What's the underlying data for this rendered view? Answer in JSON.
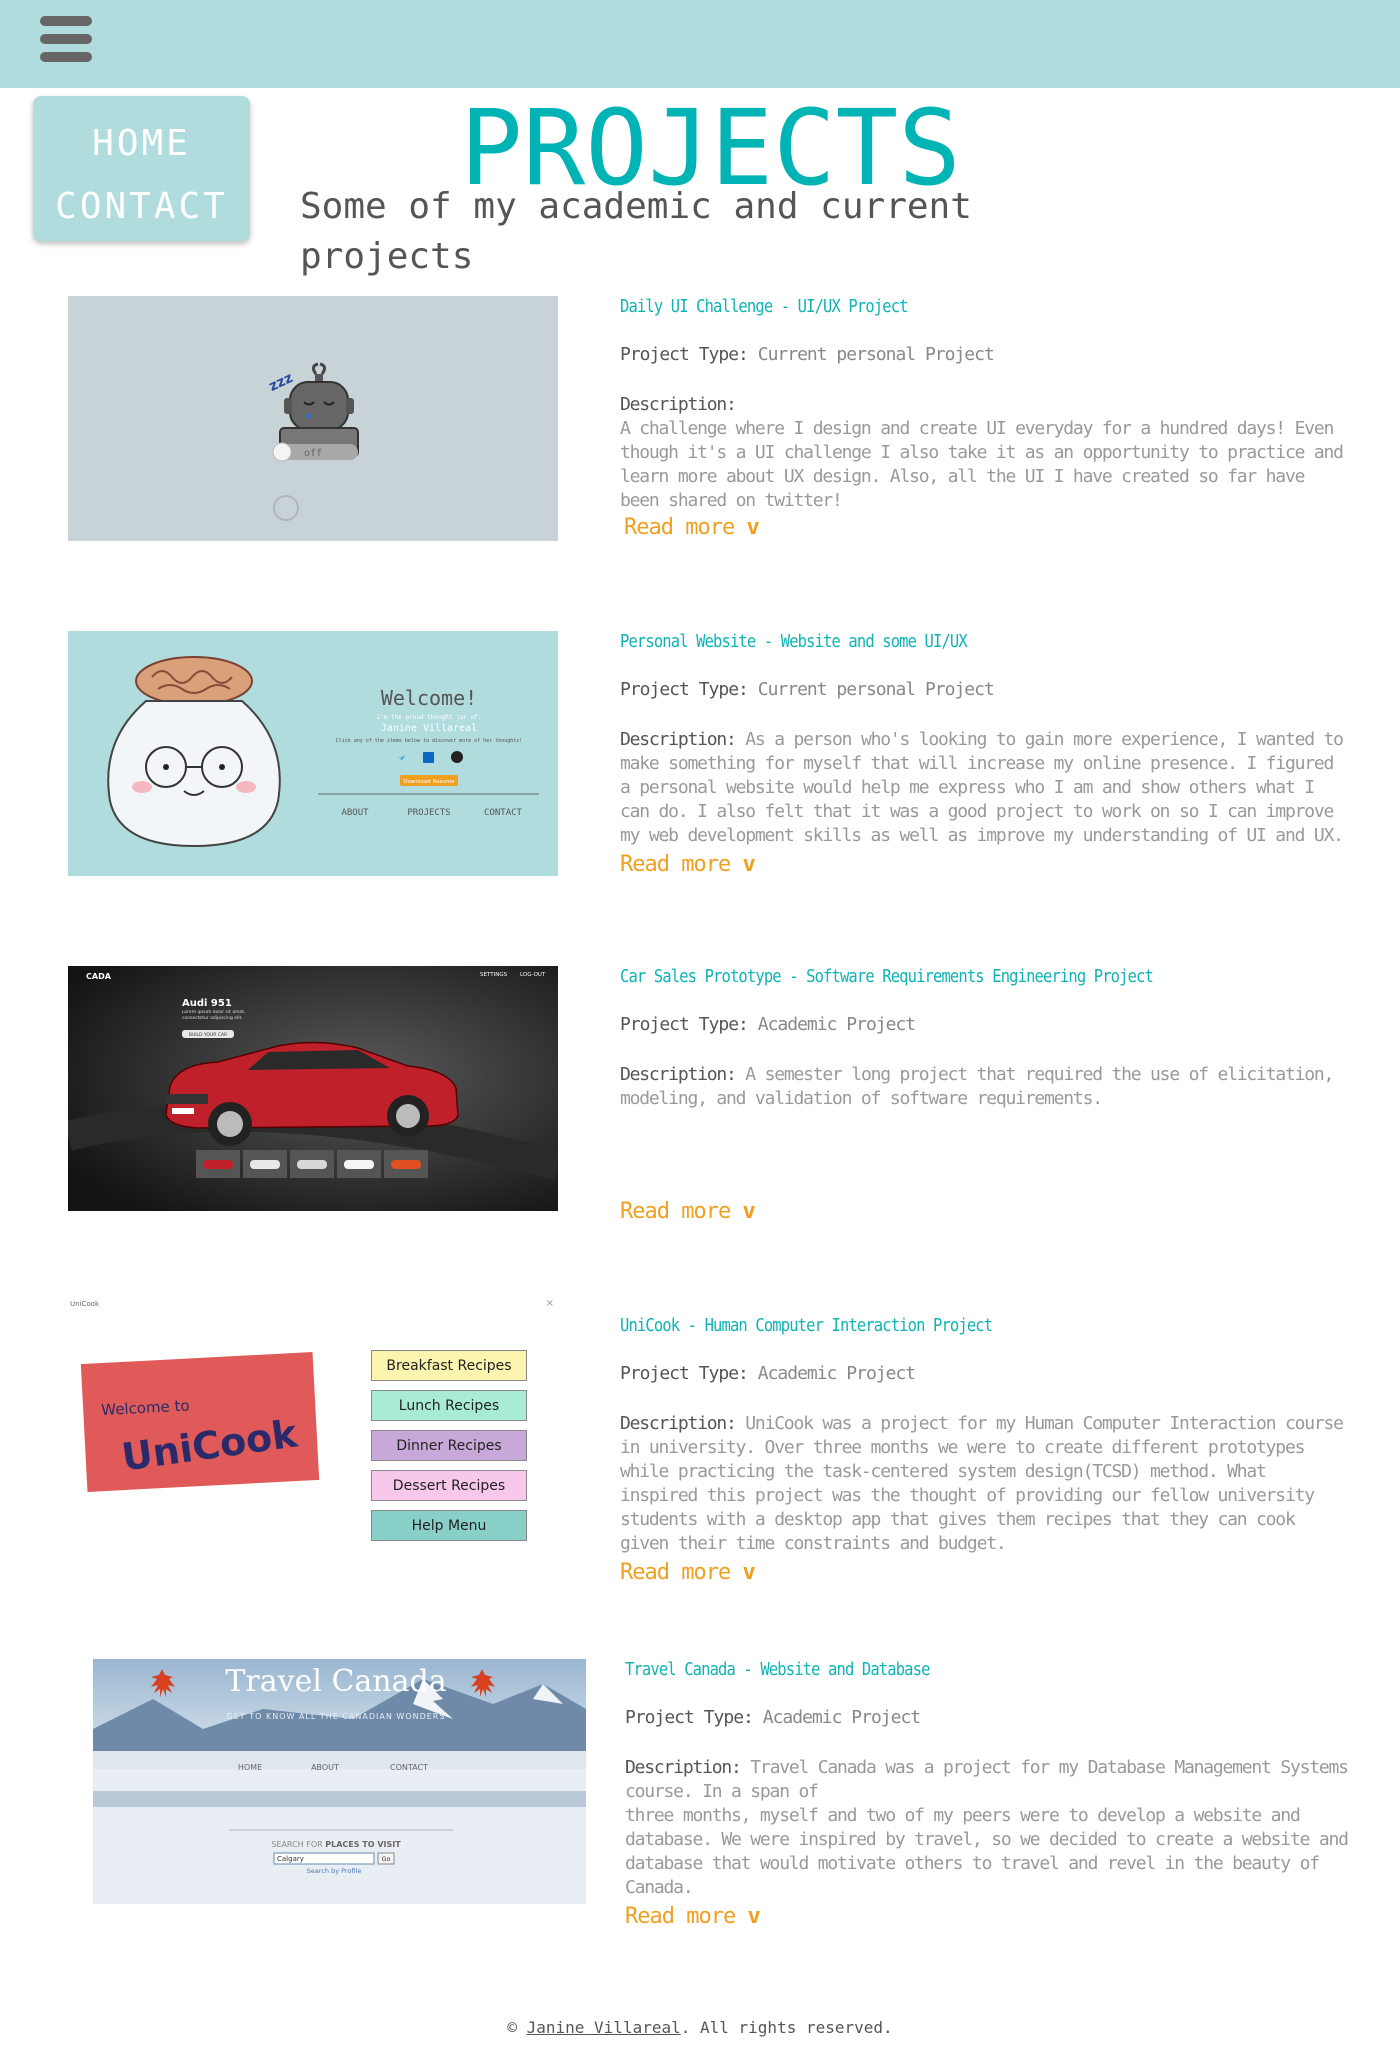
{
  "nav": {
    "items": [
      {
        "label": "HOME"
      },
      {
        "label": "CONTACT"
      }
    ]
  },
  "header": {
    "title": "PROJECTS",
    "subtitle": "Some of my academic and current projects"
  },
  "labels": {
    "project_type": "Project Type:",
    "description": "Description:",
    "read_more": "Read more",
    "chevron": "v"
  },
  "projects": [
    {
      "title": "Daily UI Challenge - UI/UX Project",
      "type": "Current personal Project",
      "description": "A challenge where I design and create UI everyday for a hundred days! Even though it's a UI challenge I also take it as an opportunity to practice and learn more about UX design. Also, all the UI I have created so far have been shared on twitter!",
      "thumb": {
        "toggle_label": "off",
        "sleep_label": "zzz"
      }
    },
    {
      "title": "Personal Website - Website and some UI/UX",
      "type": "Current personal Project",
      "description": "As a person who's looking to gain more experience, I wanted to make something for myself that will increase my online presence. I figured a personal website would help me express who I am and show others what I can do. I also felt that it was a good project to work on so I can improve my web development skills as well as improve my understanding of UI and UX.",
      "thumb": {
        "welcome": "Welcome!",
        "tagline": "I'm the proud thought jar of:",
        "name": "Janine Villareal",
        "hint": "Click any of the items below to discover more of her thoughts!",
        "download": "Download Resume",
        "links": [
          "ABOUT",
          "PROJECTS",
          "CONTACT"
        ]
      }
    },
    {
      "title": "Car Sales Prototype - Software Requirements Engineering Project",
      "type": "Academic Project",
      "description": "A semester long project that required the use of elicitation, modeling, and validation of software requirements.",
      "thumb": {
        "brand": "CADA",
        "settings": "SETTINGS",
        "logout": "LOG-OUT",
        "model": "Audi 951",
        "blurb": "Lorem ipsum dolor sit amet, consectetur adipiscing elit.",
        "cta": "BUILD YOUR CAR",
        "car_colors": [
          "#c0202a",
          "#e8e8e8",
          "#d8d8d8",
          "#f4f4f4",
          "#e05020"
        ]
      }
    },
    {
      "title": "UniCook - Human Computer Interaction Project",
      "type": "Academic Project",
      "description": "UniCook was a project for my Human Computer Interaction course in university. Over three months we were to create different prototypes while practicing the task-centered system design(TCSD) method. What inspired this project was the thought of providing our fellow university students with a desktop app that gives them recipes that they can cook given their time constraints and budget.",
      "thumb": {
        "window_title": "UniCook",
        "welcome": "Welcome to",
        "logo": "UniCook",
        "buttons": [
          {
            "label": "Breakfast Recipes",
            "color": "#fbf5b0"
          },
          {
            "label": "Lunch Recipes",
            "color": "#a8ecd8"
          },
          {
            "label": "Dinner Recipes",
            "color": "#c8a8d8"
          },
          {
            "label": "Dessert Recipes",
            "color": "#f8c8ec"
          },
          {
            "label": "Help Menu",
            "color": "#88d0c8"
          }
        ]
      }
    },
    {
      "title": "Travel Canada - Website and Database",
      "type": "Academic Project",
      "description_lines": [
        "Travel Canada was a project for my Database Management Systems course. In a span of",
        "three months, myself and two of my peers were to develop a website and database. We were inspired by travel, so we decided to create a website and database that would motivate others to travel and revel in the beauty of Canada."
      ],
      "thumb": {
        "site_title": "Travel Canada",
        "tagline": "GET TO KNOW ALL THE CANADIAN WONDERS",
        "links": [
          "HOME",
          "ABOUT",
          "CONTACT"
        ],
        "search_label_prefix": "SEARCH FOR ",
        "search_label_bold": "PLACES TO VISIT",
        "search_value": "Calgary",
        "go": "Go",
        "search_by": "Search by Profile"
      }
    }
  ],
  "footer": {
    "copyright": "©",
    "name": "Janine Villareal",
    "rest": ". All rights reserved."
  },
  "colors": {
    "accent": "#00b3b5",
    "topbar": "#b0dcdd",
    "readmore": "#f0a020"
  }
}
